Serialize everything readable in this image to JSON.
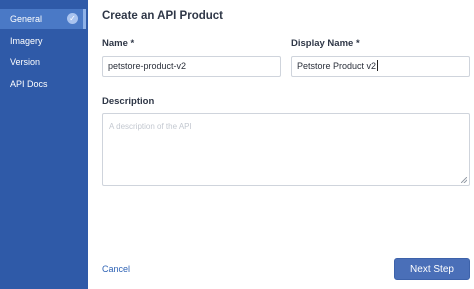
{
  "sidebar": {
    "items": [
      {
        "label": "General",
        "active": true,
        "completed": true
      },
      {
        "label": "Imagery"
      },
      {
        "label": "Version"
      },
      {
        "label": "API Docs"
      }
    ]
  },
  "main": {
    "title": "Create an API Product",
    "name": {
      "label": "Name *",
      "value": "petstore-product-v2"
    },
    "display_name": {
      "label": "Display Name *",
      "value": "Petstore Product v2"
    },
    "description": {
      "label": "Description",
      "placeholder": "A description of the API"
    }
  },
  "footer": {
    "cancel_label": "Cancel",
    "next_label": "Next Step"
  },
  "colors": {
    "sidebar": "#2f5aa8",
    "sidebar_active": "#4a79c6",
    "primary_button": "#4a6fb8",
    "link": "#2f63b5"
  }
}
